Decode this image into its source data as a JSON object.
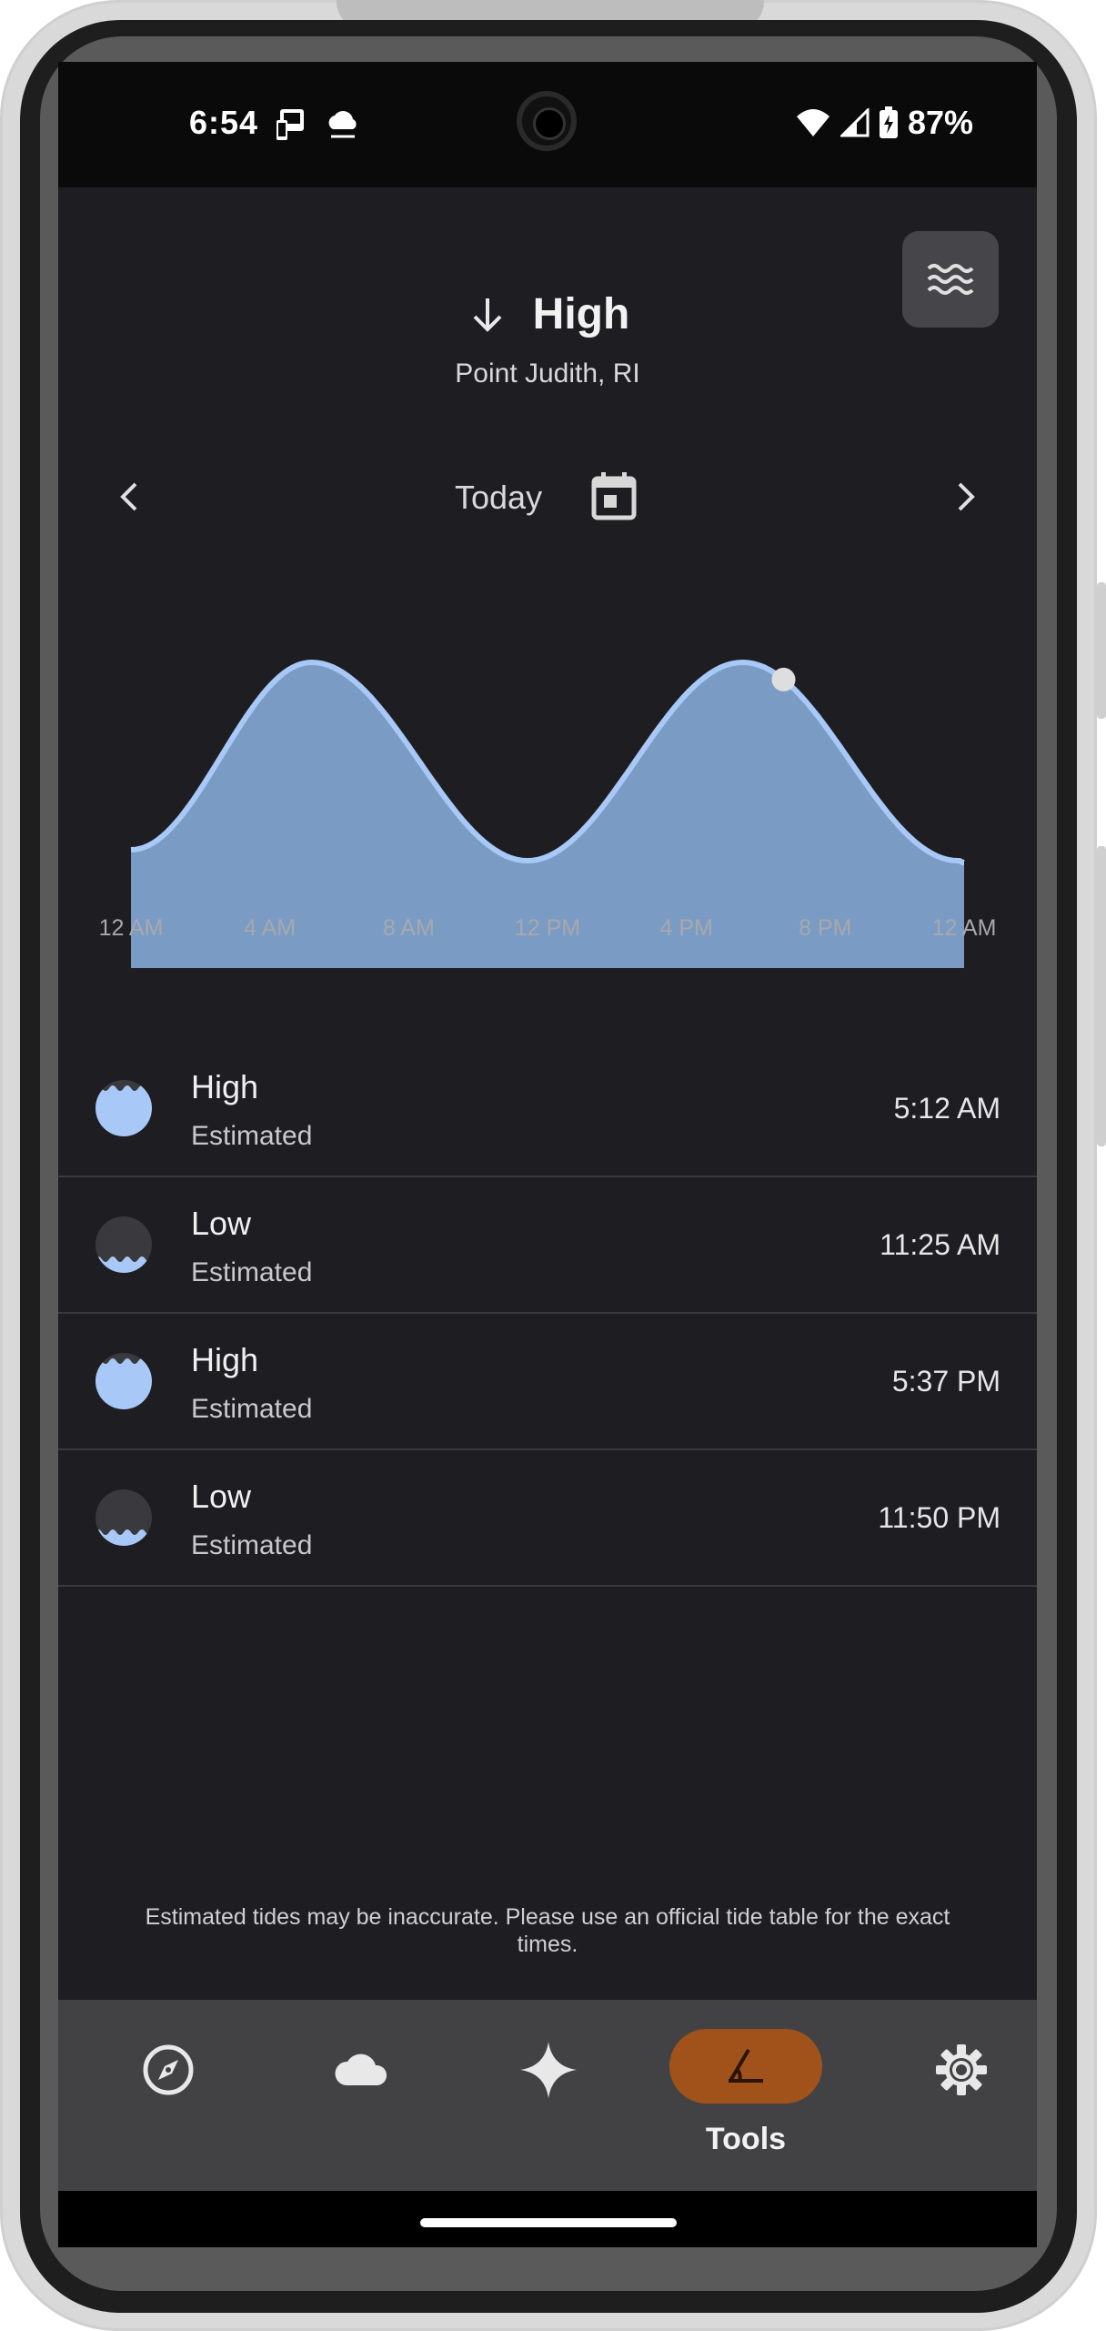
{
  "status_bar": {
    "time": "6:54",
    "battery": "87%",
    "left_icons": [
      "cast-icon",
      "cloud-icon"
    ],
    "right_icons": [
      "wifi-icon",
      "signal-icon",
      "battery-charging-icon"
    ]
  },
  "header": {
    "title": "High",
    "location": "Point Judith, RI"
  },
  "date_nav": {
    "label": "Today"
  },
  "chart_data": {
    "type": "area",
    "x_ticks": [
      "12 AM",
      "4 AM",
      "8 AM",
      "12 PM",
      "4 PM",
      "8 PM",
      "12 AM"
    ],
    "x": [
      0,
      1,
      2,
      3,
      4,
      5,
      5.2,
      6,
      7,
      8,
      9,
      10,
      11,
      11.4,
      12,
      13,
      14,
      15,
      16,
      17,
      17.6,
      18,
      19,
      20,
      21,
      22,
      23,
      23.8,
      24
    ],
    "current_time_hours": 18.8,
    "fill_color": "#7a9cc4",
    "line_color": "#a8c8f8",
    "marker_color": "#dedede",
    "extrema": [
      {
        "type": "High",
        "hours": 5.2
      },
      {
        "type": "Low",
        "hours": 11.42
      },
      {
        "type": "High",
        "hours": 17.62
      },
      {
        "type": "Low",
        "hours": 23.83
      }
    ]
  },
  "tides": [
    {
      "type": "High",
      "subtitle": "Estimated",
      "time": "5:12 AM",
      "kind": "high"
    },
    {
      "type": "Low",
      "subtitle": "Estimated",
      "time": "11:25 AM",
      "kind": "low"
    },
    {
      "type": "High",
      "subtitle": "Estimated",
      "time": "5:37 PM",
      "kind": "high"
    },
    {
      "type": "Low",
      "subtitle": "Estimated",
      "time": "11:50 PM",
      "kind": "low"
    }
  ],
  "disclaimer": "Estimated tides may be inaccurate. Please use an official tide table for the exact times.",
  "bottom_nav": {
    "items": [
      {
        "icon": "compass-icon"
      },
      {
        "icon": "cloud-icon"
      },
      {
        "icon": "sparkle-icon"
      },
      {
        "icon": "protractor-icon",
        "label": "Tools",
        "selected": true
      },
      {
        "icon": "gear-icon"
      }
    ],
    "selected_label": "Tools",
    "selected_color": "#a0521a"
  }
}
